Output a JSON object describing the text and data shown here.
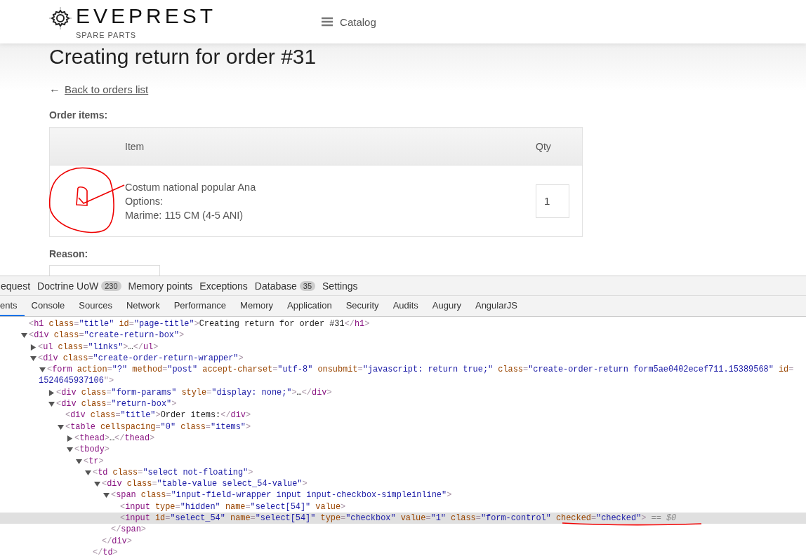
{
  "header": {
    "brand": "EVEPREST",
    "tagline": "SPARE PARTS",
    "nav": [
      {
        "label": "Catalog"
      }
    ]
  },
  "page": {
    "title": "Creating return for order #31",
    "back_link": "Back to orders list",
    "back_arrow": "←",
    "section_title": "Order items:",
    "table": {
      "columns": [
        "Item",
        "Qty"
      ],
      "rows": [
        {
          "item_lines": [
            "Costum national popular Ana",
            "Options:",
            "Marime: 115 CM (4-5 ANI)"
          ],
          "qty": "1"
        }
      ]
    },
    "reason_label": "Reason:"
  },
  "profiler_bar": [
    {
      "label": "equest"
    },
    {
      "label": "Doctrine UoW",
      "badge": "230"
    },
    {
      "label": "Memory points"
    },
    {
      "label": "Exceptions"
    },
    {
      "label": "Database",
      "badge": "35"
    },
    {
      "label": "Settings"
    }
  ],
  "devtools_tabs": [
    {
      "label": "ents",
      "selected": true
    },
    {
      "label": "Console",
      "selected": false
    },
    {
      "label": "Sources",
      "selected": false
    },
    {
      "label": "Network",
      "selected": false
    },
    {
      "label": "Performance",
      "selected": false
    },
    {
      "label": "Memory",
      "selected": false
    },
    {
      "label": "Application",
      "selected": false
    },
    {
      "label": "Security",
      "selected": false
    },
    {
      "label": "Audits",
      "selected": false
    },
    {
      "label": "Augury",
      "selected": false
    },
    {
      "label": "AngularJS",
      "selected": false
    }
  ],
  "dom": [
    {
      "kind": "leaf",
      "html": "<h1 class=\"title\" id=\"page-title\">Creating return for order #31</h1>",
      "selected": false
    },
    {
      "kind": "element",
      "html": "<div class=\"create-return-box\">",
      "expanded": true,
      "selected": false,
      "children": [
        {
          "kind": "element",
          "html": "<ul class=\"links\">…</ul>",
          "expanded": false,
          "selected": false
        },
        {
          "kind": "element",
          "html": "<div class=\"create-order-return-wrapper\">",
          "expanded": true,
          "selected": false,
          "children": [
            {
              "kind": "element",
              "html": "<form action=\"?\" method=\"post\" accept-charset=\"utf-8\" onsubmit=\"javascript: return true;\" class=\"create-order-return form5ae0402ecef711.15389568\" id=",
              "continuation": "1524645937106\">",
              "expanded": true,
              "selected": false,
              "children": [
                {
                  "kind": "element",
                  "html": "<div class=\"form-params\" style=\"display: none;\">…</div>",
                  "expanded": false,
                  "selected": false
                },
                {
                  "kind": "element",
                  "html": "<div class=\"return-box\">",
                  "expanded": true,
                  "selected": false,
                  "children": [
                    {
                      "kind": "leaf",
                      "html": "<div class=\"title\">Order items:</div>",
                      "selected": false
                    },
                    {
                      "kind": "element",
                      "html": "<table cellspacing=\"0\" class=\"items\">",
                      "expanded": true,
                      "selected": false,
                      "children": [
                        {
                          "kind": "element",
                          "html": "<thead>…</thead>",
                          "expanded": false,
                          "selected": false
                        },
                        {
                          "kind": "element",
                          "html": "<tbody>",
                          "expanded": true,
                          "selected": false,
                          "children": [
                            {
                              "kind": "element",
                              "html": "<tr>",
                              "expanded": true,
                              "selected": false,
                              "children": [
                                {
                                  "kind": "element",
                                  "html": "<td class=\"select not-floating\">",
                                  "expanded": true,
                                  "selected": false,
                                  "children": [
                                    {
                                      "kind": "element",
                                      "html": "<div class=\"table-value select_54-value\">",
                                      "expanded": true,
                                      "selected": false,
                                      "children": [
                                        {
                                          "kind": "element",
                                          "html": "<span class=\"input-field-wrapper input input-checkbox-simpleinline\">",
                                          "expanded": true,
                                          "selected": false,
                                          "children": [
                                            {
                                              "kind": "leaf",
                                              "html": "<input type=\"hidden\" name=\"select[54]\" value>",
                                              "selected": false
                                            },
                                            {
                                              "kind": "leaf",
                                              "html": "<input id=\"select_54\" name=\"select[54]\" type=\"checkbox\" value=\"1\" class=\"form-control\" checked=\"checked\">",
                                              "console_ref": "== $0",
                                              "selected": true
                                            }
                                          ]
                                        },
                                        {
                                          "kind": "leaf",
                                          "html": "</span>",
                                          "selected": false
                                        }
                                      ]
                                    },
                                    {
                                      "kind": "leaf",
                                      "html": "</div>",
                                      "selected": false
                                    }
                                  ]
                                },
                                {
                                  "kind": "leaf",
                                  "html": "</td>",
                                  "selected": false
                                }
                              ]
                            }
                          ]
                        }
                      ]
                    }
                  ]
                }
              ]
            }
          ]
        }
      ]
    }
  ]
}
